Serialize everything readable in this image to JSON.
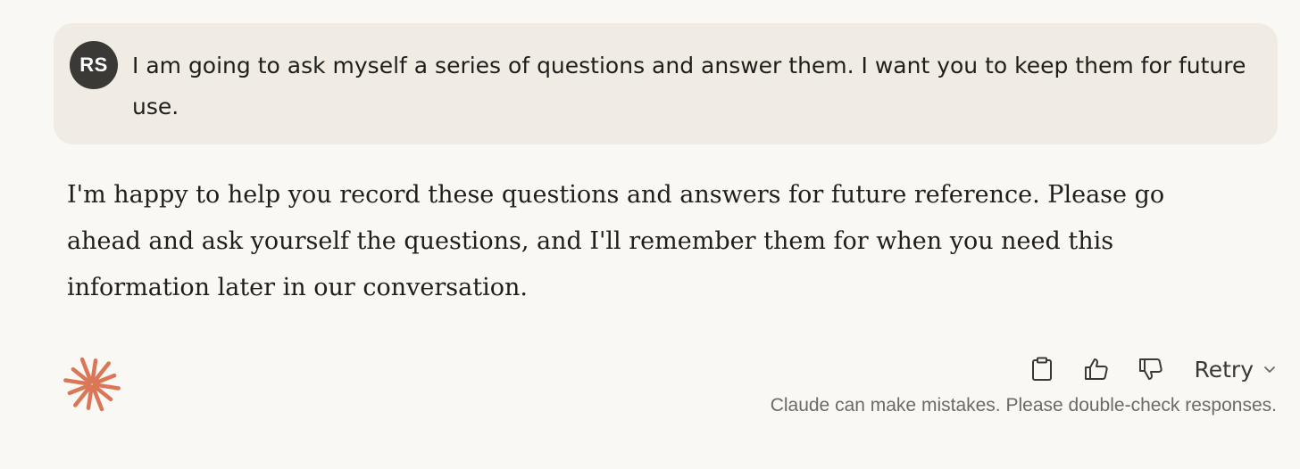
{
  "user_message": {
    "avatar_initials": "RS",
    "text": "I am going to ask myself a series of questions and answer them. I want you to keep them for future use."
  },
  "assistant_message": {
    "text": "I'm happy to help you record these questions and answers for future reference. Please go ahead and ask yourself the questions, and I'll remember them for when you need this information later in our conversation."
  },
  "actions": {
    "copy_icon": "clipboard-icon",
    "thumbs_up_icon": "thumbs-up-icon",
    "thumbs_down_icon": "thumbs-down-icon",
    "retry_label": "Retry",
    "retry_chevron_icon": "chevron-down-icon"
  },
  "disclaimer": "Claude can make mistakes. Please double-check responses.",
  "colors": {
    "background": "#faf8f4",
    "user_bubble": "#f0ece4",
    "avatar_bg": "#3a3936",
    "claude_brand": "#d97757",
    "text_primary": "#1f1e1b",
    "text_muted": "#6b6a66"
  }
}
